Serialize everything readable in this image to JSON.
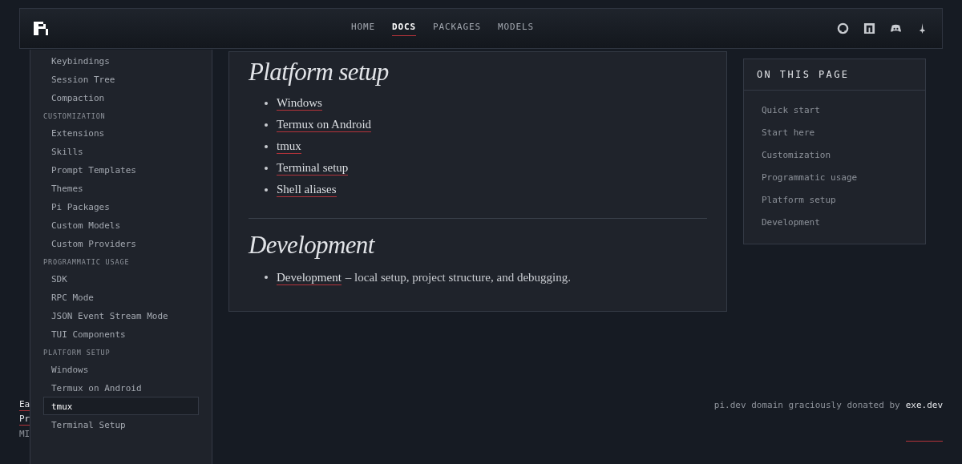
{
  "nav": {
    "links": [
      {
        "label": "HOME",
        "selected": false
      },
      {
        "label": "DOCS",
        "selected": true
      },
      {
        "label": "PACKAGES",
        "selected": false
      },
      {
        "label": "MODELS",
        "selected": false
      }
    ],
    "icons": [
      {
        "kind": "cat"
      },
      {
        "kind": "square"
      },
      {
        "kind": "controller"
      },
      {
        "kind": "pin"
      }
    ]
  },
  "sidebar": {
    "items": [
      {
        "kind": "item",
        "label": "Keybindings",
        "selected": false
      },
      {
        "kind": "item",
        "label": "Session Tree",
        "selected": false
      },
      {
        "kind": "item",
        "label": "Compaction",
        "selected": false
      },
      {
        "kind": "section",
        "label": "CUSTOMIZATION"
      },
      {
        "kind": "item",
        "label": "Extensions",
        "selected": false
      },
      {
        "kind": "item",
        "label": "Skills",
        "selected": false
      },
      {
        "kind": "item",
        "label": "Prompt Templates",
        "selected": false
      },
      {
        "kind": "item",
        "label": "Themes",
        "selected": false
      },
      {
        "kind": "item",
        "label": "Pi Packages",
        "selected": false
      },
      {
        "kind": "item",
        "label": "Custom Models",
        "selected": false
      },
      {
        "kind": "item",
        "label": "Custom Providers",
        "selected": false
      },
      {
        "kind": "section",
        "label": "PROGRAMMATIC USAGE"
      },
      {
        "kind": "item",
        "label": "SDK",
        "selected": false
      },
      {
        "kind": "item",
        "label": "RPC Mode",
        "selected": false
      },
      {
        "kind": "item",
        "label": "JSON Event Stream Mode",
        "selected": false
      },
      {
        "kind": "item",
        "label": "TUI Components",
        "selected": false
      },
      {
        "kind": "section",
        "label": "PLATFORM SETUP"
      },
      {
        "kind": "item",
        "label": "Windows",
        "selected": false
      },
      {
        "kind": "item",
        "label": "Termux on Android",
        "selected": false
      },
      {
        "kind": "item",
        "label": "tmux",
        "selected": true
      },
      {
        "kind": "item",
        "label": "Terminal Setup",
        "selected": false
      }
    ]
  },
  "content": {
    "sections": [
      {
        "heading": "Platform setup",
        "items": [
          {
            "link": "Windows"
          },
          {
            "link": "Termux on Android"
          },
          {
            "link": "tmux"
          },
          {
            "link": "Terminal setup"
          },
          {
            "link": "Shell aliases"
          }
        ]
      },
      {
        "heading": "Development",
        "items": [
          {
            "link": "Development",
            "description": "– local setup, project structure, and debugging."
          }
        ]
      }
    ]
  },
  "toc": {
    "title": "ON THIS PAGE",
    "items": [
      "Quick start",
      "Start here",
      "Customization",
      "Programmatic usage",
      "Platform setup",
      "Development"
    ]
  },
  "footer": {
    "left": [
      {
        "text": "Ea",
        "kind": "link"
      },
      {
        "text": "Pr",
        "kind": "link"
      },
      {
        "text": "MI",
        "kind": "text"
      }
    ],
    "credit": "pi.dev domain graciously donated by",
    "credit_link": "exe.dev"
  }
}
